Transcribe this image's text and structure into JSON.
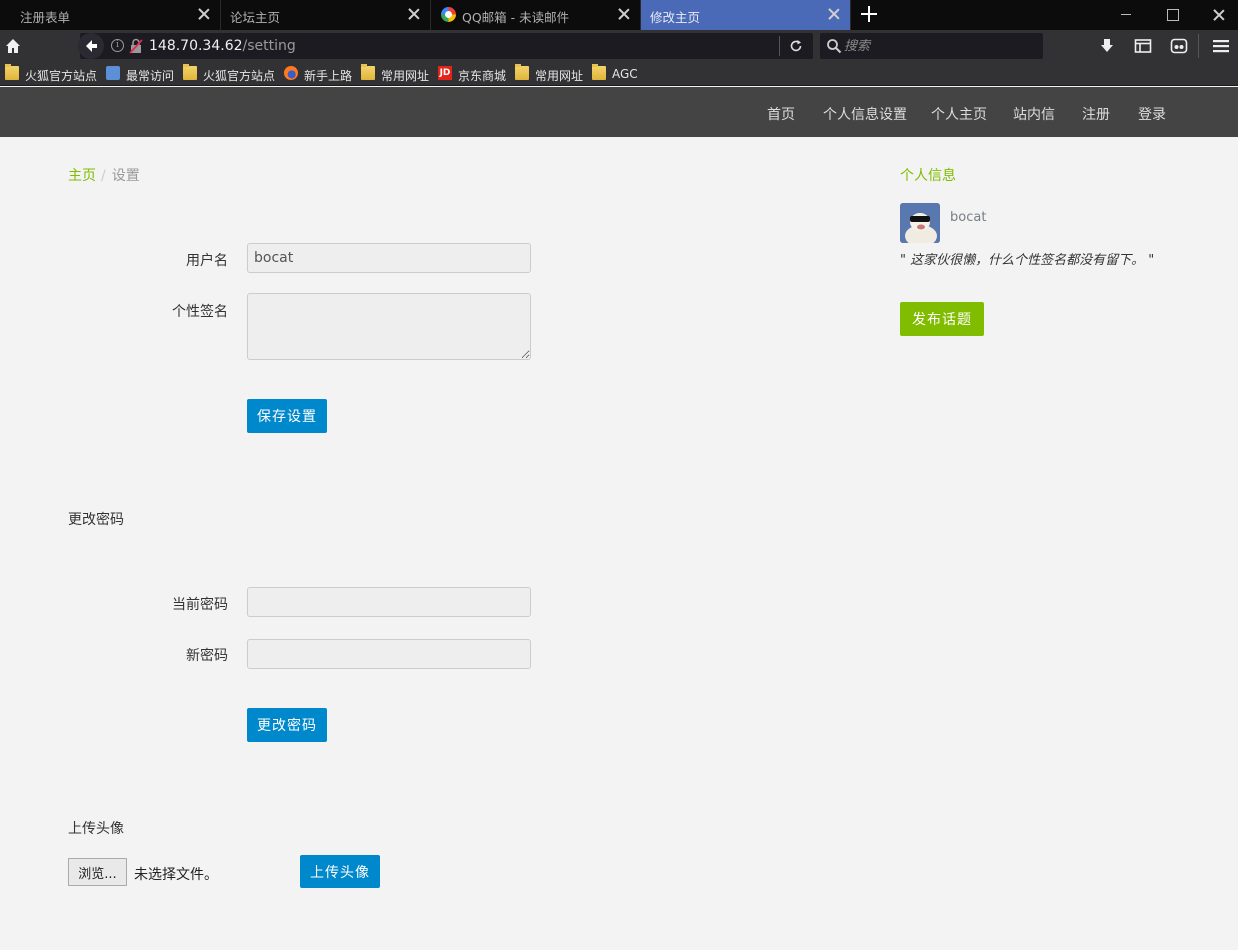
{
  "browser": {
    "tabs": [
      {
        "title": "注册表单"
      },
      {
        "title": "论坛主页"
      },
      {
        "title": "QQ邮箱 - 未读邮件"
      },
      {
        "title": "修改主页"
      }
    ],
    "url": {
      "host": "148.70.34.62",
      "path": "/setting"
    },
    "search_placeholder": "搜索",
    "bookmarks": [
      "火狐官方站点",
      "最常访问",
      "火狐官方站点",
      "新手上路",
      "常用网址",
      "京东商城",
      "常用网址",
      "AGC"
    ],
    "jd_badge": "JD",
    "info_glyph": "i"
  },
  "site_nav": {
    "items": [
      "首页",
      "个人信息设置",
      "个人主页",
      "站内信",
      "注册",
      "登录"
    ]
  },
  "breadcrumb": {
    "home": "主页",
    "separator": "/",
    "current": "设置"
  },
  "settings_form": {
    "username_label": "用户名",
    "username_value": "bocat",
    "signature_label": "个性签名",
    "signature_value": "",
    "save_button": "保存设置"
  },
  "password_section": {
    "title": "更改密码",
    "current_label": "当前密码",
    "new_label": "新密码",
    "submit_button": "更改密码"
  },
  "avatar_section": {
    "title": "上传头像",
    "browse_button": "浏览...",
    "file_status": "未选择文件。",
    "upload_button": "上传头像"
  },
  "sidebar": {
    "title": "个人信息",
    "username": "bocat",
    "signature": "\" 这家伙很懒，什么个性签名都没有留下。 \"",
    "publish_button": "发布话题"
  },
  "colors": {
    "accent_green": "#80bd01",
    "button_blue": "#0088cc",
    "nav_bg": "#444444",
    "active_tab": "#4a69b6"
  }
}
